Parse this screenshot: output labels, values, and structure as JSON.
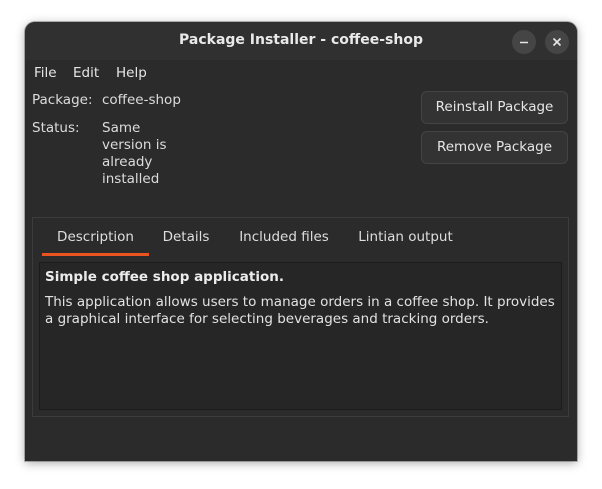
{
  "window": {
    "title": "Package Installer - coffee-shop",
    "controls": {
      "minimize_icon": "minimize-icon",
      "close_icon": "close-icon"
    }
  },
  "menubar": {
    "items": [
      {
        "label": "File"
      },
      {
        "label": "Edit"
      },
      {
        "label": "Help"
      }
    ]
  },
  "info": {
    "package_label": "Package:",
    "package_value": "coffee-shop",
    "status_label": "Status:",
    "status_value": "Same version is already installed"
  },
  "actions": {
    "reinstall_label": "Reinstall Package",
    "remove_label": "Remove Package"
  },
  "tabs": {
    "items": [
      {
        "label": "Description",
        "active": true
      },
      {
        "label": "Details",
        "active": false
      },
      {
        "label": "Included files",
        "active": false
      },
      {
        "label": "Lintian output",
        "active": false
      }
    ]
  },
  "description": {
    "title": "Simple coffee shop application.",
    "body": "This application allows users to manage orders in a coffee shop. It provides a graphical interface for selecting beverages and tracking orders."
  },
  "colors": {
    "accent": "#e95420",
    "window_bg": "#2b2b2b",
    "titlebar_bg": "#303030"
  }
}
